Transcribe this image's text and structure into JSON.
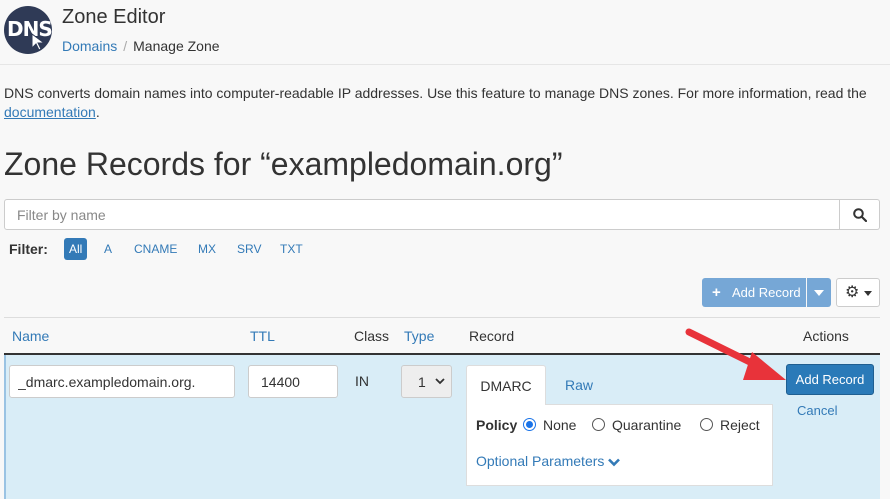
{
  "app": {
    "logo_text": "DNS",
    "title": "Zone Editor",
    "breadcrumb": {
      "parent": "Domains",
      "separator": "/",
      "current": "Manage Zone"
    }
  },
  "description": {
    "text": "DNS converts domain names into computer-readable IP addresses. Use this feature to manage DNS zones. For more information, read the ",
    "link": "documentation",
    "suffix": "."
  },
  "page_title": "Zone Records for “exampledomain.org”",
  "search": {
    "placeholder": "Filter by name",
    "icon": "search-icon"
  },
  "filter": {
    "label": "Filter:",
    "options": [
      "All",
      "A",
      "CNAME",
      "MX",
      "SRV",
      "TXT"
    ],
    "active": "All"
  },
  "toolbar": {
    "add_record_label": "Add Record",
    "add_icon": "plus-icon",
    "settings_icon": "gear-icon"
  },
  "table": {
    "headers": {
      "name": "Name",
      "ttl": "TTL",
      "class": "Class",
      "type": "Type",
      "record": "Record",
      "actions": "Actions"
    }
  },
  "edit_row": {
    "name_value": "_dmarc.exampledomain.org.",
    "ttl_value": "14400",
    "class_value": "IN",
    "type_value": "1",
    "tabs": {
      "dmarc": "DMARC",
      "raw": "Raw",
      "active": "DMARC"
    },
    "policy": {
      "label": "Policy",
      "options": [
        "None",
        "Quarantine",
        "Reject"
      ],
      "selected": "None"
    },
    "optional_params_label": "Optional Parameters",
    "add_record_button": "Add Record",
    "cancel_link": "Cancel"
  },
  "colors": {
    "link": "#337ab7",
    "primary_button": "#2a7ab8",
    "row_highlight": "#d9edf7",
    "annotation_arrow": "#e8333a"
  }
}
